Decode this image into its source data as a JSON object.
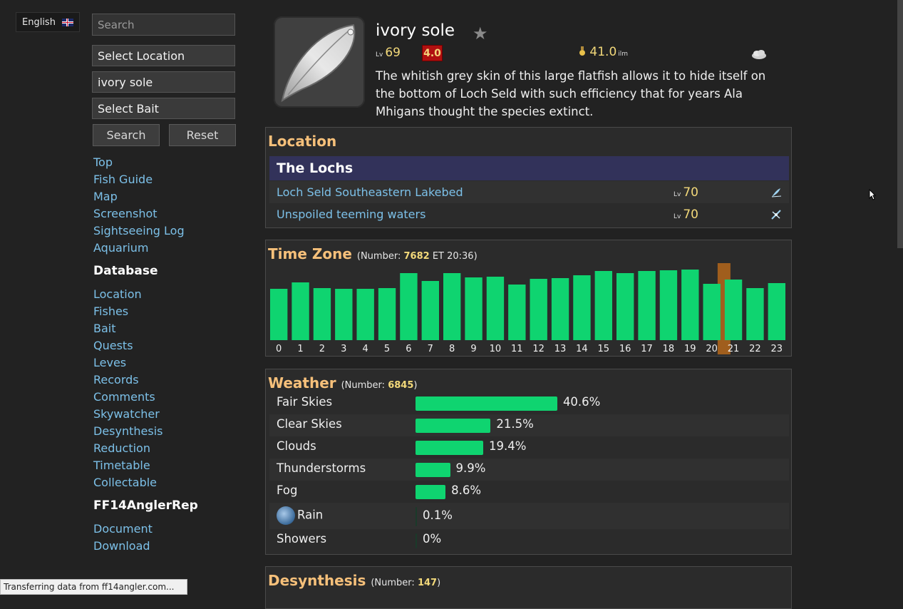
{
  "language": {
    "label": "English"
  },
  "search": {
    "placeholder": "Search",
    "location_select": "Select Location",
    "fish_value": "ivory sole",
    "bait_select": "Select Bait",
    "search_button": "Search",
    "reset_button": "Reset"
  },
  "nav": {
    "main": [
      "Top",
      "Fish Guide",
      "Map",
      "Screenshot",
      "Sightseeing Log",
      "Aquarium"
    ],
    "database_heading": "Database",
    "database": [
      "Location",
      "Fishes",
      "Bait",
      "Quests",
      "Leves",
      "Records",
      "Comments",
      "Skywatcher",
      "Desynthesis",
      "Reduction",
      "Timetable",
      "Collectable"
    ],
    "angler_heading": "FF14AnglerRep",
    "angler": [
      "Document",
      "Download"
    ]
  },
  "fish": {
    "name": "ivory sole",
    "level": "69",
    "level_prefix": "Lv",
    "rating": "4.0",
    "size": "41.0",
    "size_unit": "ilm",
    "description": "The whitish grey skin of this large flatfish allows it to hide itself on the bottom of Loch Seld with such efficiency that for years Ala Mhigans thought the species extinct."
  },
  "location": {
    "title": "Location",
    "zone": "The Lochs",
    "spots": [
      {
        "name": "Loch Seld Southeastern Lakebed",
        "level": "70",
        "icon": "fishing-spot-icon"
      },
      {
        "name": "Unspoiled teeming waters",
        "level": "70",
        "icon": "spearfishing-icon"
      }
    ]
  },
  "timezone": {
    "title": "Time Zone",
    "number_label": "(Number:",
    "number": "7682",
    "et_label": "ET 20:36)"
  },
  "weather": {
    "title": "Weather",
    "number_label": "(Number:",
    "number": "6845",
    "close": ")",
    "rows": [
      {
        "name": "Fair Skies",
        "pct": "40.6%",
        "value": 40.6
      },
      {
        "name": "Clear Skies",
        "pct": "21.5%",
        "value": 21.5
      },
      {
        "name": "Clouds",
        "pct": "19.4%",
        "value": 19.4
      },
      {
        "name": "Thunderstorms",
        "pct": "9.9%",
        "value": 9.9
      },
      {
        "name": "Fog",
        "pct": "8.6%",
        "value": 8.6
      },
      {
        "name": "Rain",
        "pct": "0.1%",
        "value": 0.1
      },
      {
        "name": "Showers",
        "pct": "0%",
        "value": 0
      }
    ]
  },
  "desynthesis": {
    "title": "Desynthesis",
    "number_label": "(Number:",
    "number": "147",
    "close": ")"
  },
  "status_bar": "Transferring data from ff14angler.com...",
  "colors": {
    "accent": "#f6c07a",
    "bar": "#0fd470",
    "link": "#7cc0e8",
    "highlight": "#c8701a"
  },
  "chart_data": {
    "type": "bar",
    "categories": [
      "0",
      "1",
      "2",
      "3",
      "4",
      "5",
      "6",
      "7",
      "8",
      "9",
      "10",
      "11",
      "12",
      "13",
      "14",
      "15",
      "16",
      "17",
      "18",
      "19",
      "20",
      "21",
      "22",
      "23"
    ],
    "values": [
      72,
      81,
      73,
      72,
      72,
      73,
      94,
      83,
      94,
      88,
      89,
      78,
      86,
      87,
      91,
      97,
      94,
      97,
      98,
      99,
      79,
      85,
      73,
      80
    ],
    "highlight_category": "20",
    "ylim": [
      0,
      100
    ]
  }
}
